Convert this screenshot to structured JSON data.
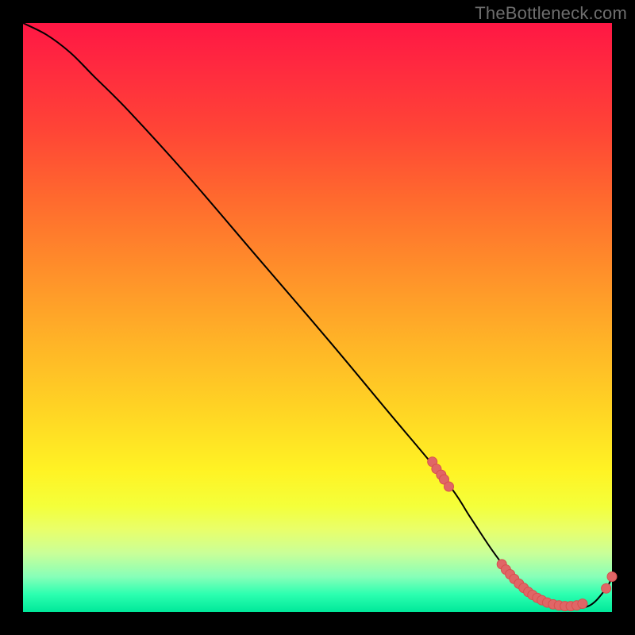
{
  "watermark": "TheBottleneck.com",
  "chart_data": {
    "type": "line",
    "title": "",
    "xlabel": "",
    "ylabel": "",
    "xlim": [
      0,
      100
    ],
    "ylim": [
      0,
      100
    ],
    "grid": false,
    "series": [
      {
        "name": "curve",
        "x": [
          0,
          4,
          8,
          12,
          18,
          28,
          40,
          52,
          62,
          72,
          76,
          80,
          84,
          88,
          92,
          96,
          99,
          100
        ],
        "y": [
          100,
          98,
          95,
          91,
          85,
          74,
          60,
          46,
          34,
          22,
          16,
          10,
          5,
          2,
          1,
          1,
          4,
          6
        ]
      }
    ],
    "points": [
      {
        "x": 69.5,
        "y": 25.5
      },
      {
        "x": 70.2,
        "y": 24.3
      },
      {
        "x": 71.0,
        "y": 23.3
      },
      {
        "x": 71.5,
        "y": 22.5
      },
      {
        "x": 72.3,
        "y": 21.3
      },
      {
        "x": 81.3,
        "y": 8.1
      },
      {
        "x": 82.0,
        "y": 7.2
      },
      {
        "x": 82.7,
        "y": 6.4
      },
      {
        "x": 83.4,
        "y": 5.6
      },
      {
        "x": 84.2,
        "y": 4.8
      },
      {
        "x": 85.0,
        "y": 4.1
      },
      {
        "x": 85.8,
        "y": 3.4
      },
      {
        "x": 86.5,
        "y": 2.9
      },
      {
        "x": 87.3,
        "y": 2.4
      },
      {
        "x": 88.1,
        "y": 2.0
      },
      {
        "x": 89.0,
        "y": 1.6
      },
      {
        "x": 90.0,
        "y": 1.3
      },
      {
        "x": 91.0,
        "y": 1.1
      },
      {
        "x": 92.0,
        "y": 1.0
      },
      {
        "x": 93.0,
        "y": 1.0
      },
      {
        "x": 94.0,
        "y": 1.1
      },
      {
        "x": 95.0,
        "y": 1.4
      },
      {
        "x": 99.0,
        "y": 4.0
      },
      {
        "x": 100.0,
        "y": 6.0
      }
    ]
  },
  "colors": {
    "background": "#000000",
    "curve": "#000000",
    "dot_fill": "#e06666",
    "watermark": "#6e6e6e"
  }
}
